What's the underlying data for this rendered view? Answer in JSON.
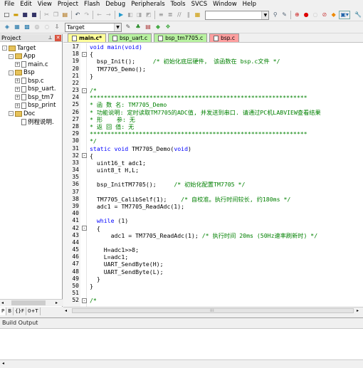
{
  "menu": [
    "File",
    "Edit",
    "View",
    "Project",
    "Flash",
    "Debug",
    "Peripherals",
    "Tools",
    "SVCS",
    "Window",
    "Help"
  ],
  "toolbar": {
    "target_name": "Target"
  },
  "project_panel": {
    "title": "Project",
    "tree": [
      {
        "label": "Target",
        "level": 0,
        "kind": "folder",
        "expander": "-"
      },
      {
        "label": "App",
        "level": 1,
        "kind": "folder",
        "expander": "-"
      },
      {
        "label": "main.c",
        "level": 2,
        "kind": "file",
        "expander": "+"
      },
      {
        "label": "Bsp",
        "level": 1,
        "kind": "folder",
        "expander": "-"
      },
      {
        "label": "bsp.c",
        "level": 2,
        "kind": "file",
        "expander": "+"
      },
      {
        "label": "bsp_uart.",
        "level": 2,
        "kind": "file",
        "expander": "+"
      },
      {
        "label": "bsp_tm7",
        "level": 2,
        "kind": "file",
        "expander": "+"
      },
      {
        "label": "bsp_print",
        "level": 2,
        "kind": "file",
        "expander": "+"
      },
      {
        "label": "Doc",
        "level": 1,
        "kind": "folder",
        "expander": "-"
      },
      {
        "label": "例程说明.",
        "level": 2,
        "kind": "file",
        "expander": ""
      }
    ],
    "bottom_tabs": [
      "P",
      "B",
      "{}F",
      "0+T"
    ]
  },
  "editor": {
    "tabs": [
      {
        "label": "main.c*",
        "bg": "#ffff9a",
        "active": true
      },
      {
        "label": "bsp_uart.c",
        "bg": "#b8f2a0",
        "active": false
      },
      {
        "label": "bsp_tm7705.c",
        "bg": "#b8f2a0",
        "active": false
      },
      {
        "label": "bsp.c",
        "bg": "#ff9f9f",
        "active": false
      }
    ],
    "lines": [
      {
        "n": "17",
        "f": "",
        "t": [
          [
            "void main(void)",
            "kw2"
          ]
        ]
      },
      {
        "n": "18",
        "f": "-",
        "t": [
          [
            "{",
            "p"
          ]
        ]
      },
      {
        "n": "19",
        "f": "",
        "t": [
          [
            "  bsp_Init();     ",
            "p"
          ],
          [
            "/* 初始化底层硬件， 该函数在 bsp.c文件 */",
            "cm"
          ]
        ]
      },
      {
        "n": "20",
        "f": "",
        "t": [
          [
            "  TM7705_Demo();",
            "p"
          ]
        ]
      },
      {
        "n": "21",
        "f": "",
        "t": [
          [
            "}",
            "p"
          ]
        ]
      },
      {
        "n": "22",
        "f": "",
        "t": [
          [
            "",
            "p"
          ]
        ]
      },
      {
        "n": "23",
        "f": "-",
        "t": [
          [
            "/*",
            "cm"
          ]
        ]
      },
      {
        "n": "24",
        "f": "",
        "t": [
          [
            "**************************************************************",
            "cm"
          ]
        ]
      },
      {
        "n": "25",
        "f": "",
        "t": [
          [
            "* 函 数 名: TM7705_Demo",
            "cm"
          ]
        ]
      },
      {
        "n": "26",
        "f": "",
        "t": [
          [
            "* 功能说明: 定时读取TM7705的ADC值, 并发送到串口. 请通过PC机LABVIEW查看结果",
            "cm"
          ]
        ]
      },
      {
        "n": "27",
        "f": "",
        "t": [
          [
            "* 形    参: 无",
            "cm"
          ]
        ]
      },
      {
        "n": "28",
        "f": "",
        "t": [
          [
            "* 返 回 值: 无",
            "cm"
          ]
        ]
      },
      {
        "n": "29",
        "f": "",
        "t": [
          [
            "**************************************************************",
            "cm"
          ]
        ]
      },
      {
        "n": "30",
        "f": "",
        "t": [
          [
            "*/",
            "cm"
          ]
        ]
      },
      {
        "n": "31",
        "f": "",
        "t": [
          [
            "static void ",
            "kw"
          ],
          [
            "TM7705_Demo(",
            "p"
          ],
          [
            "void",
            "kw"
          ],
          [
            ")",
            "p"
          ]
        ]
      },
      {
        "n": "32",
        "f": "-",
        "t": [
          [
            "{",
            "p"
          ]
        ]
      },
      {
        "n": "33",
        "f": "",
        "t": [
          [
            "  uint16_t adc1;",
            "p"
          ]
        ]
      },
      {
        "n": "34",
        "f": "",
        "t": [
          [
            "  uint8_t H,L;",
            "p"
          ]
        ]
      },
      {
        "n": "35",
        "f": "",
        "t": [
          [
            "",
            "p"
          ]
        ]
      },
      {
        "n": "36",
        "f": "",
        "t": [
          [
            "  bsp_InitTM7705();     ",
            "p"
          ],
          [
            "/* 初始化配置TM7705 */",
            "cm"
          ]
        ]
      },
      {
        "n": "37",
        "f": "",
        "t": [
          [
            "",
            "p"
          ]
        ]
      },
      {
        "n": "38",
        "f": "",
        "t": [
          [
            "  TM7705_CalibSelf(1);    ",
            "p"
          ],
          [
            "/* 自校准。执行时间较长, 约180ms */",
            "cm"
          ]
        ]
      },
      {
        "n": "39",
        "f": "",
        "t": [
          [
            "  adc1 = TM7705_ReadAdc(1);",
            "p"
          ]
        ]
      },
      {
        "n": "40",
        "f": "",
        "t": [
          [
            "",
            "p"
          ]
        ]
      },
      {
        "n": "41",
        "f": "",
        "t": [
          [
            "  ",
            "p"
          ],
          [
            "while",
            "kw"
          ],
          [
            " (1)",
            "p"
          ]
        ]
      },
      {
        "n": "42",
        "f": "-",
        "t": [
          [
            "  {",
            "p"
          ]
        ]
      },
      {
        "n": "43",
        "f": "",
        "t": [
          [
            "      adc1 = TM7705_ReadAdc(1); ",
            "p"
          ],
          [
            "/* 执行时间 20ms (50Hz速率刷新时) */",
            "cm"
          ]
        ]
      },
      {
        "n": "44",
        "f": "",
        "t": [
          [
            "",
            "p"
          ]
        ]
      },
      {
        "n": "45",
        "f": "",
        "t": [
          [
            "    H=adc1>>8;",
            "p"
          ]
        ]
      },
      {
        "n": "46",
        "f": "",
        "t": [
          [
            "    L=adc1;",
            "p"
          ]
        ]
      },
      {
        "n": "47",
        "f": "",
        "t": [
          [
            "    UART_SendByte(H);",
            "p"
          ]
        ]
      },
      {
        "n": "48",
        "f": "",
        "t": [
          [
            "    UART_SendByte(L);",
            "p"
          ]
        ]
      },
      {
        "n": "49",
        "f": "",
        "t": [
          [
            "  }",
            "p"
          ]
        ]
      },
      {
        "n": "50",
        "f": "",
        "t": [
          [
            "}",
            "p"
          ]
        ]
      },
      {
        "n": "51",
        "f": "",
        "t": [
          [
            "",
            "p"
          ]
        ]
      },
      {
        "n": "52",
        "f": "-",
        "t": [
          [
            "/*",
            "cm"
          ]
        ]
      }
    ]
  },
  "build_output": {
    "title": "Build Output"
  },
  "colors": {
    "keyword": "#0000ff",
    "comment": "#008000"
  }
}
